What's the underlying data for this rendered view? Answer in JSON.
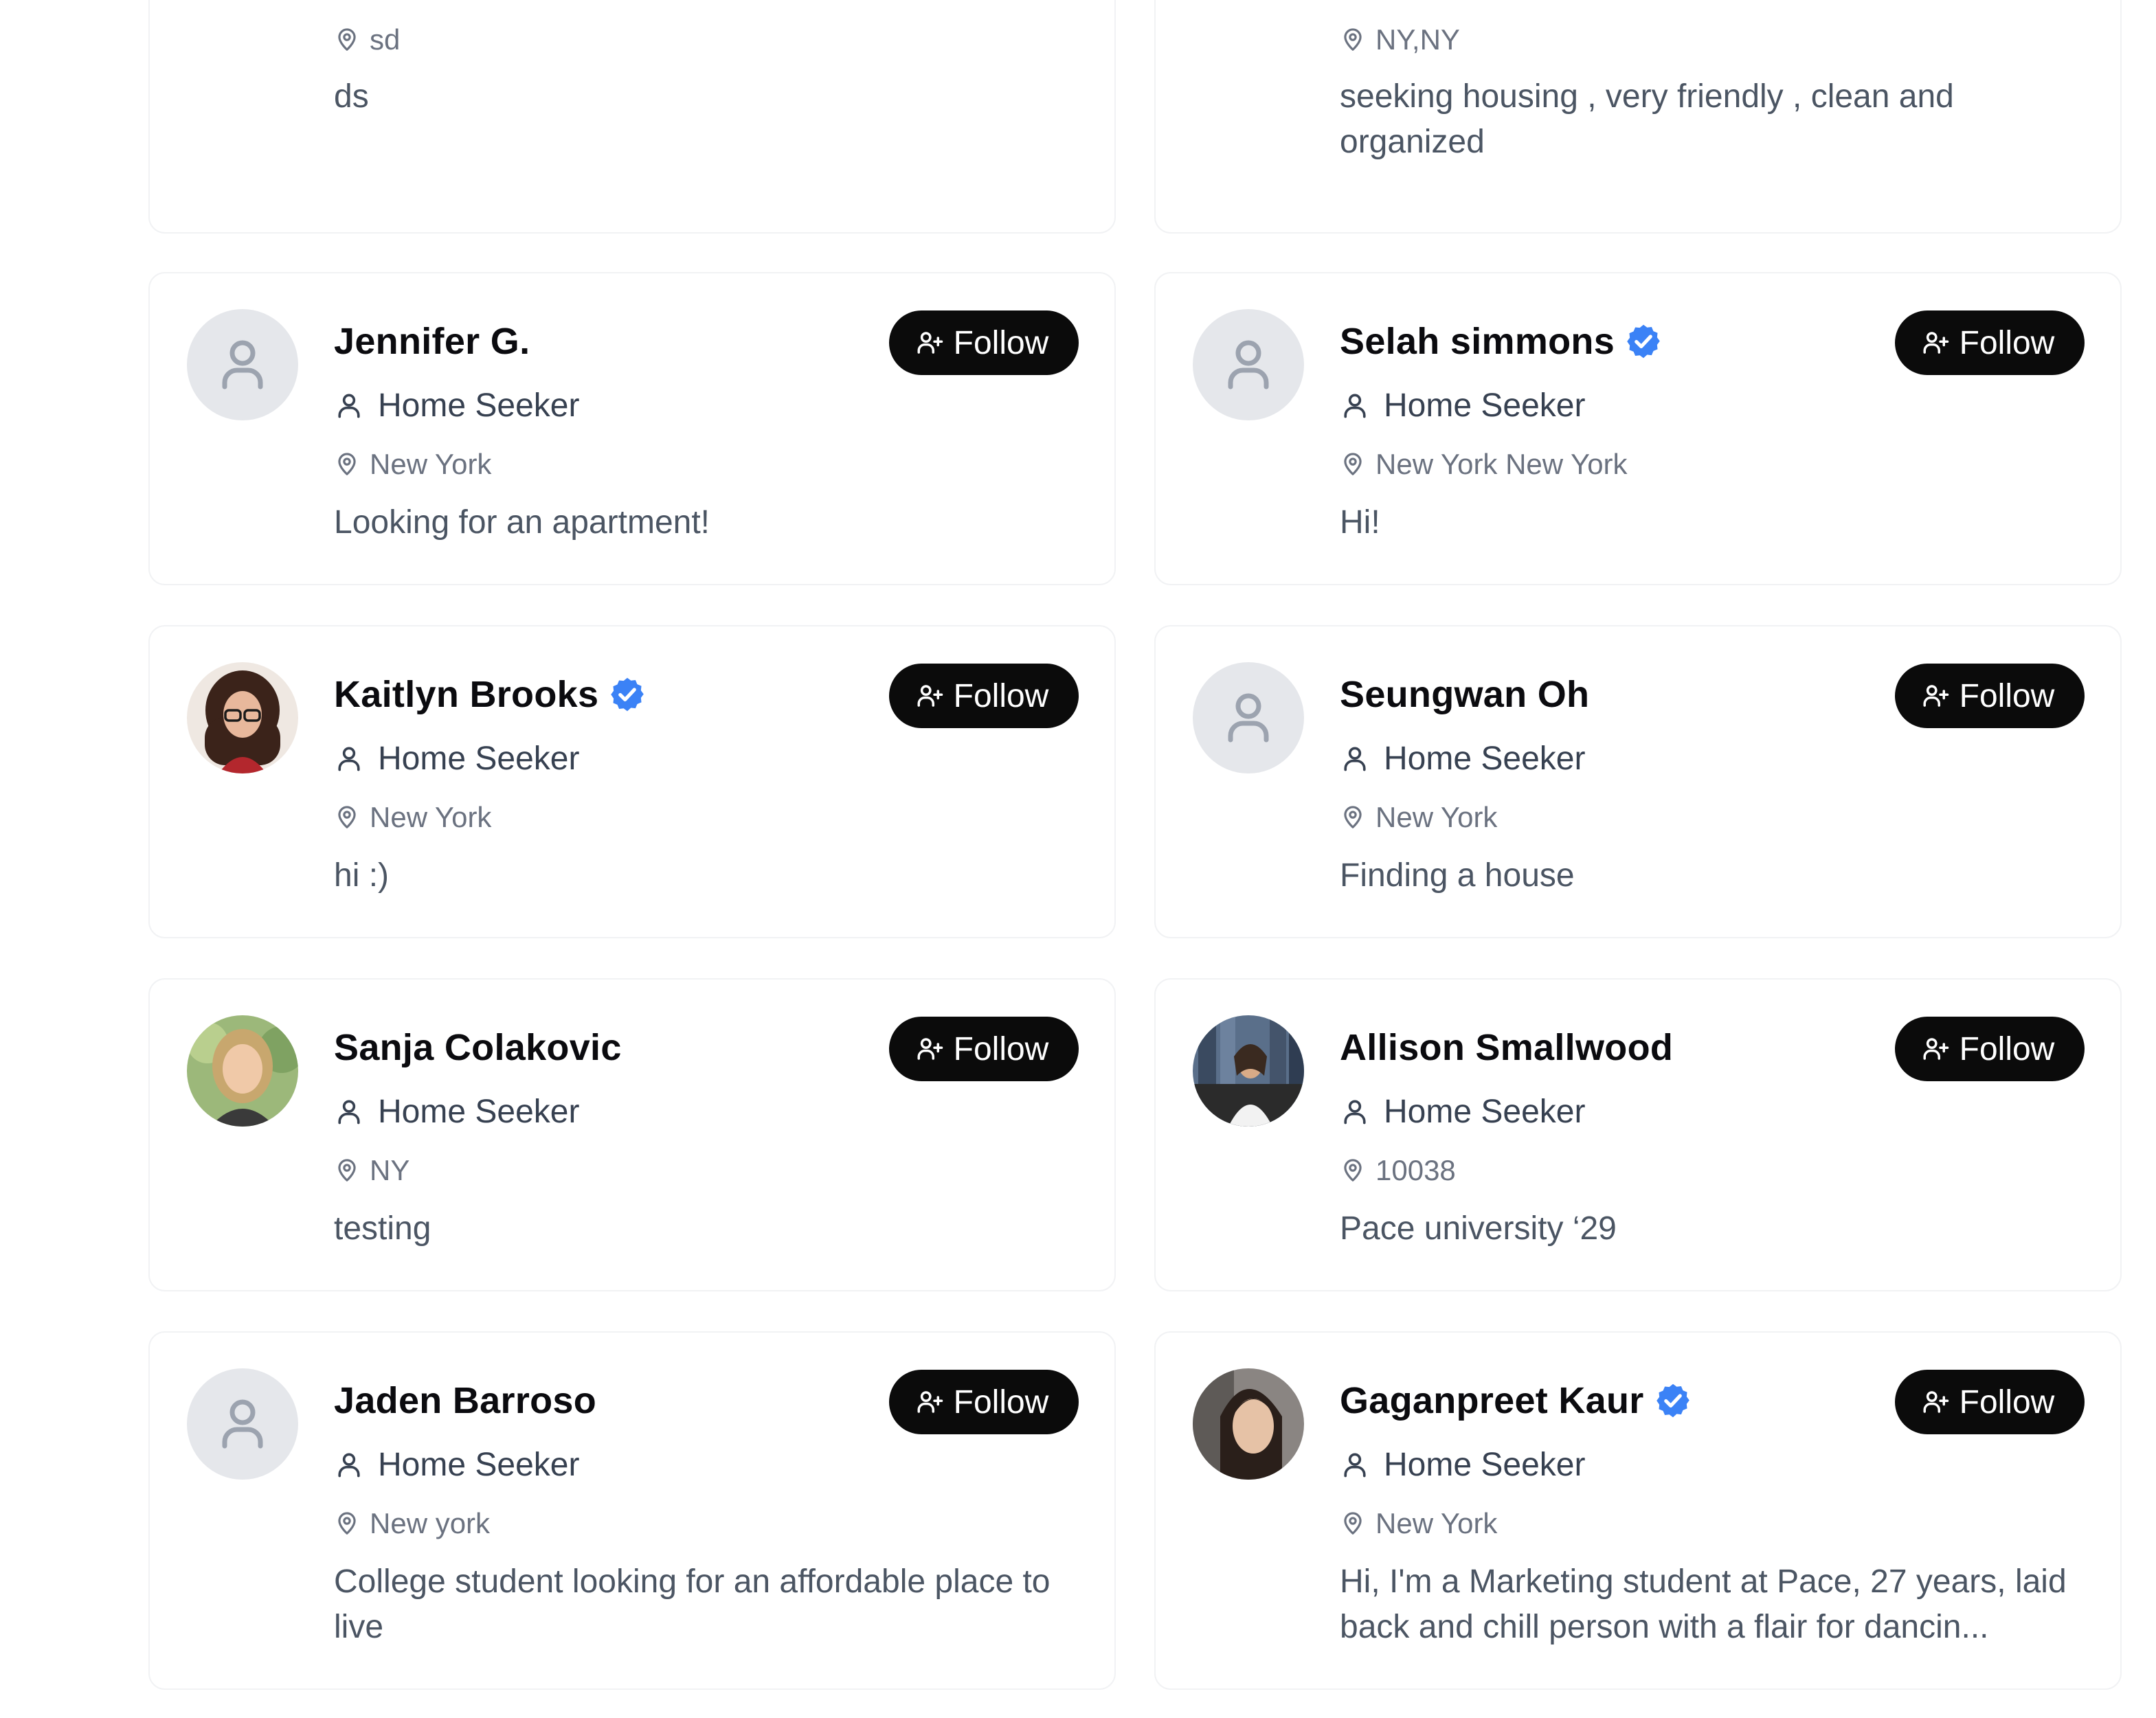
{
  "colors": {
    "follow_bg": "#0b0b0b",
    "verified_blue": "#3b82f6",
    "placeholder_avatar_bg": "#e5e7eb",
    "placeholder_icon": "#9ca3af"
  },
  "follow_label": "Follow",
  "top_cards": [
    {
      "location": "sd",
      "bio": "ds"
    },
    {
      "location": "NY,NY",
      "bio": "seeking housing , very friendly , clean and organized"
    }
  ],
  "profiles": [
    {
      "name": "Jennifer G.",
      "verified": false,
      "avatar": "placeholder-avatar-icon",
      "role": "Home Seeker",
      "location": "New York",
      "bio": "Looking for an apartment!"
    },
    {
      "name": "Selah simmons",
      "verified": true,
      "avatar": "placeholder-avatar-icon",
      "role": "Home Seeker",
      "location": "New York New York",
      "bio": "Hi!"
    },
    {
      "name": "Kaitlyn Brooks",
      "verified": true,
      "avatar": "profile-photo",
      "role": "Home Seeker",
      "location": "New York",
      "bio": "hi :)"
    },
    {
      "name": "Seungwan Oh",
      "verified": false,
      "avatar": "placeholder-avatar-icon",
      "role": "Home Seeker",
      "location": "New York",
      "bio": "Finding a house"
    },
    {
      "name": "Sanja Colakovic",
      "verified": false,
      "avatar": "profile-photo",
      "role": "Home Seeker",
      "location": "NY",
      "bio": "testing"
    },
    {
      "name": "Allison Smallwood",
      "verified": false,
      "avatar": "profile-photo",
      "role": "Home Seeker",
      "location": "10038",
      "bio": "Pace university ‘29"
    },
    {
      "name": "Jaden Barroso",
      "verified": false,
      "avatar": "placeholder-avatar-icon",
      "role": "Home Seeker",
      "location": "New york",
      "bio": "College student looking for an affordable place to live"
    },
    {
      "name": "Gaganpreet Kaur",
      "verified": true,
      "avatar": "profile-photo",
      "role": "Home Seeker",
      "location": "New York",
      "bio": "Hi, I'm a Marketing student at Pace, 27 years, laid back and chill person with a flair for dancin..."
    }
  ]
}
